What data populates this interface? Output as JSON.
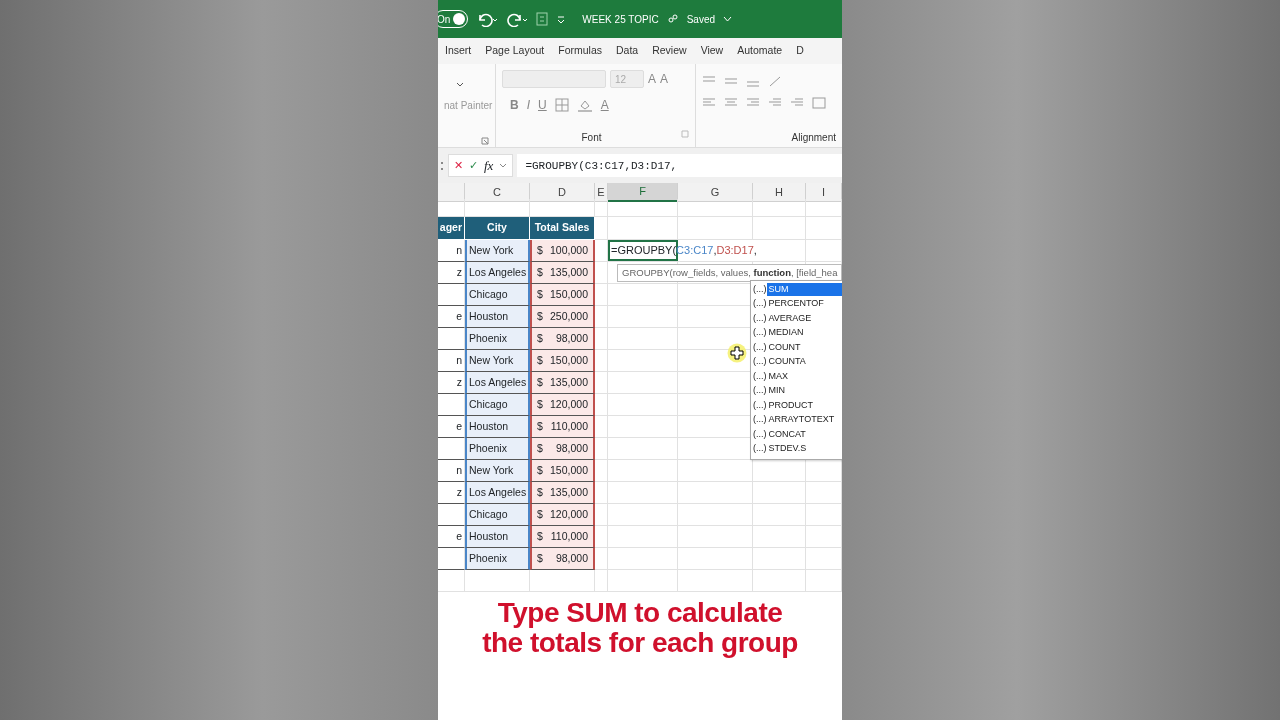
{
  "title_bar": {
    "autosave_label": "On",
    "autosave_on": true,
    "file_name": "WEEK 25 TOPIC",
    "save_status": "Saved"
  },
  "ribbon_tabs": [
    {
      "label": "Insert"
    },
    {
      "label": "Page Layout"
    },
    {
      "label": "Formulas"
    },
    {
      "label": "Data"
    },
    {
      "label": "Review"
    },
    {
      "label": "View"
    },
    {
      "label": "Automate"
    },
    {
      "label": "D"
    }
  ],
  "ribbon": {
    "clipboard_item": "nat Painter",
    "font_size": "12",
    "grow_font": "A",
    "shrink_font": "A",
    "style_buttons": [
      "B",
      "I",
      "U"
    ],
    "font_color": "A",
    "groups": [
      "Font",
      "Alignment"
    ]
  },
  "formula_bar": {
    "cancel": "✕",
    "enter": "✓",
    "function_label": "fx",
    "formula": "=GROUPBY(C3:C17,D3:D17,"
  },
  "columns": [
    {
      "label": "C",
      "selected": false
    },
    {
      "label": "D",
      "selected": false
    },
    {
      "label": "E",
      "selected": false
    },
    {
      "label": "F",
      "selected": true
    },
    {
      "label": "G",
      "selected": false
    },
    {
      "label": "H",
      "selected": false
    },
    {
      "label": "I",
      "selected": false
    }
  ],
  "table": {
    "header": [
      "ager",
      "City",
      "Total Sales"
    ],
    "rows": [
      {
        "column_b": "n",
        "city": "New York",
        "currency": "$",
        "total_sales": "100,000"
      },
      {
        "column_b": "z",
        "city": "Los Angeles",
        "currency": "$",
        "total_sales": "135,000"
      },
      {
        "city": "Chicago",
        "currency": "$",
        "total_sales": "150,000"
      },
      {
        "column_b": "e",
        "city": "Houston",
        "currency": "$",
        "total_sales": "250,000"
      },
      {
        "city": "Phoenix",
        "currency": "$",
        "total_sales": "98,000"
      },
      {
        "column_b": "n",
        "city": "New York",
        "currency": "$",
        "total_sales": "150,000"
      },
      {
        "column_b": "z",
        "city": "Los Angeles",
        "currency": "$",
        "total_sales": "135,000"
      },
      {
        "city": "Chicago",
        "currency": "$",
        "total_sales": "120,000"
      },
      {
        "column_b": "e",
        "city": "Houston",
        "currency": "$",
        "total_sales": "110,000"
      },
      {
        "city": "Phoenix",
        "currency": "$",
        "total_sales": "98,000"
      },
      {
        "column_b": "n",
        "city": "New York",
        "currency": "$",
        "total_sales": "150,000"
      },
      {
        "column_b": "z",
        "city": "Los Angeles",
        "currency": "$",
        "total_sales": "135,000"
      },
      {
        "city": "Chicago",
        "currency": "$",
        "total_sales": "120,000"
      },
      {
        "column_b": "e",
        "city": "Houston",
        "currency": "$",
        "total_sales": "110,000"
      },
      {
        "city": "Phoenix",
        "currency": "$",
        "total_sales": "98,000"
      }
    ]
  },
  "active_cell": {
    "segments": [
      {
        "text": "=GROUPBY(",
        "kind": "plain"
      },
      {
        "text": "C3:C17",
        "kind": "ref",
        "color": "#4a86c8"
      },
      {
        "text": ",",
        "kind": "plain"
      },
      {
        "text": "D3:D17",
        "kind": "ref",
        "color": "#c0504d"
      },
      {
        "text": ",",
        "kind": "plain"
      }
    ]
  },
  "tooltip": "GROUPBY(row_fields, values, **function**, [field_hea",
  "autocomplete": [
    {
      "icon": "(...)",
      "label": "SUM",
      "selected": true
    },
    {
      "icon": "(...)",
      "label": "PERCENTOF",
      "selected": false
    },
    {
      "icon": "(...)",
      "label": "AVERAGE",
      "selected": false
    },
    {
      "icon": "(...)",
      "label": "MEDIAN",
      "selected": false
    },
    {
      "icon": "(...)",
      "label": "COUNT",
      "selected": false
    },
    {
      "icon": "(...)",
      "label": "COUNTA",
      "selected": false
    },
    {
      "icon": "(...)",
      "label": "MAX",
      "selected": false
    },
    {
      "icon": "(...)",
      "label": "MIN",
      "selected": false
    },
    {
      "icon": "(...)",
      "label": "PRODUCT",
      "selected": false
    },
    {
      "icon": "(...)",
      "label": "ARRAYTOTEXT",
      "selected": false
    },
    {
      "icon": "(...)",
      "label": "CONCAT",
      "selected": false
    },
    {
      "icon": "(...)",
      "label": "STDEV.S",
      "selected": false
    }
  ],
  "caption": [
    "Type SUM to calculate",
    "the totals for each group"
  ]
}
